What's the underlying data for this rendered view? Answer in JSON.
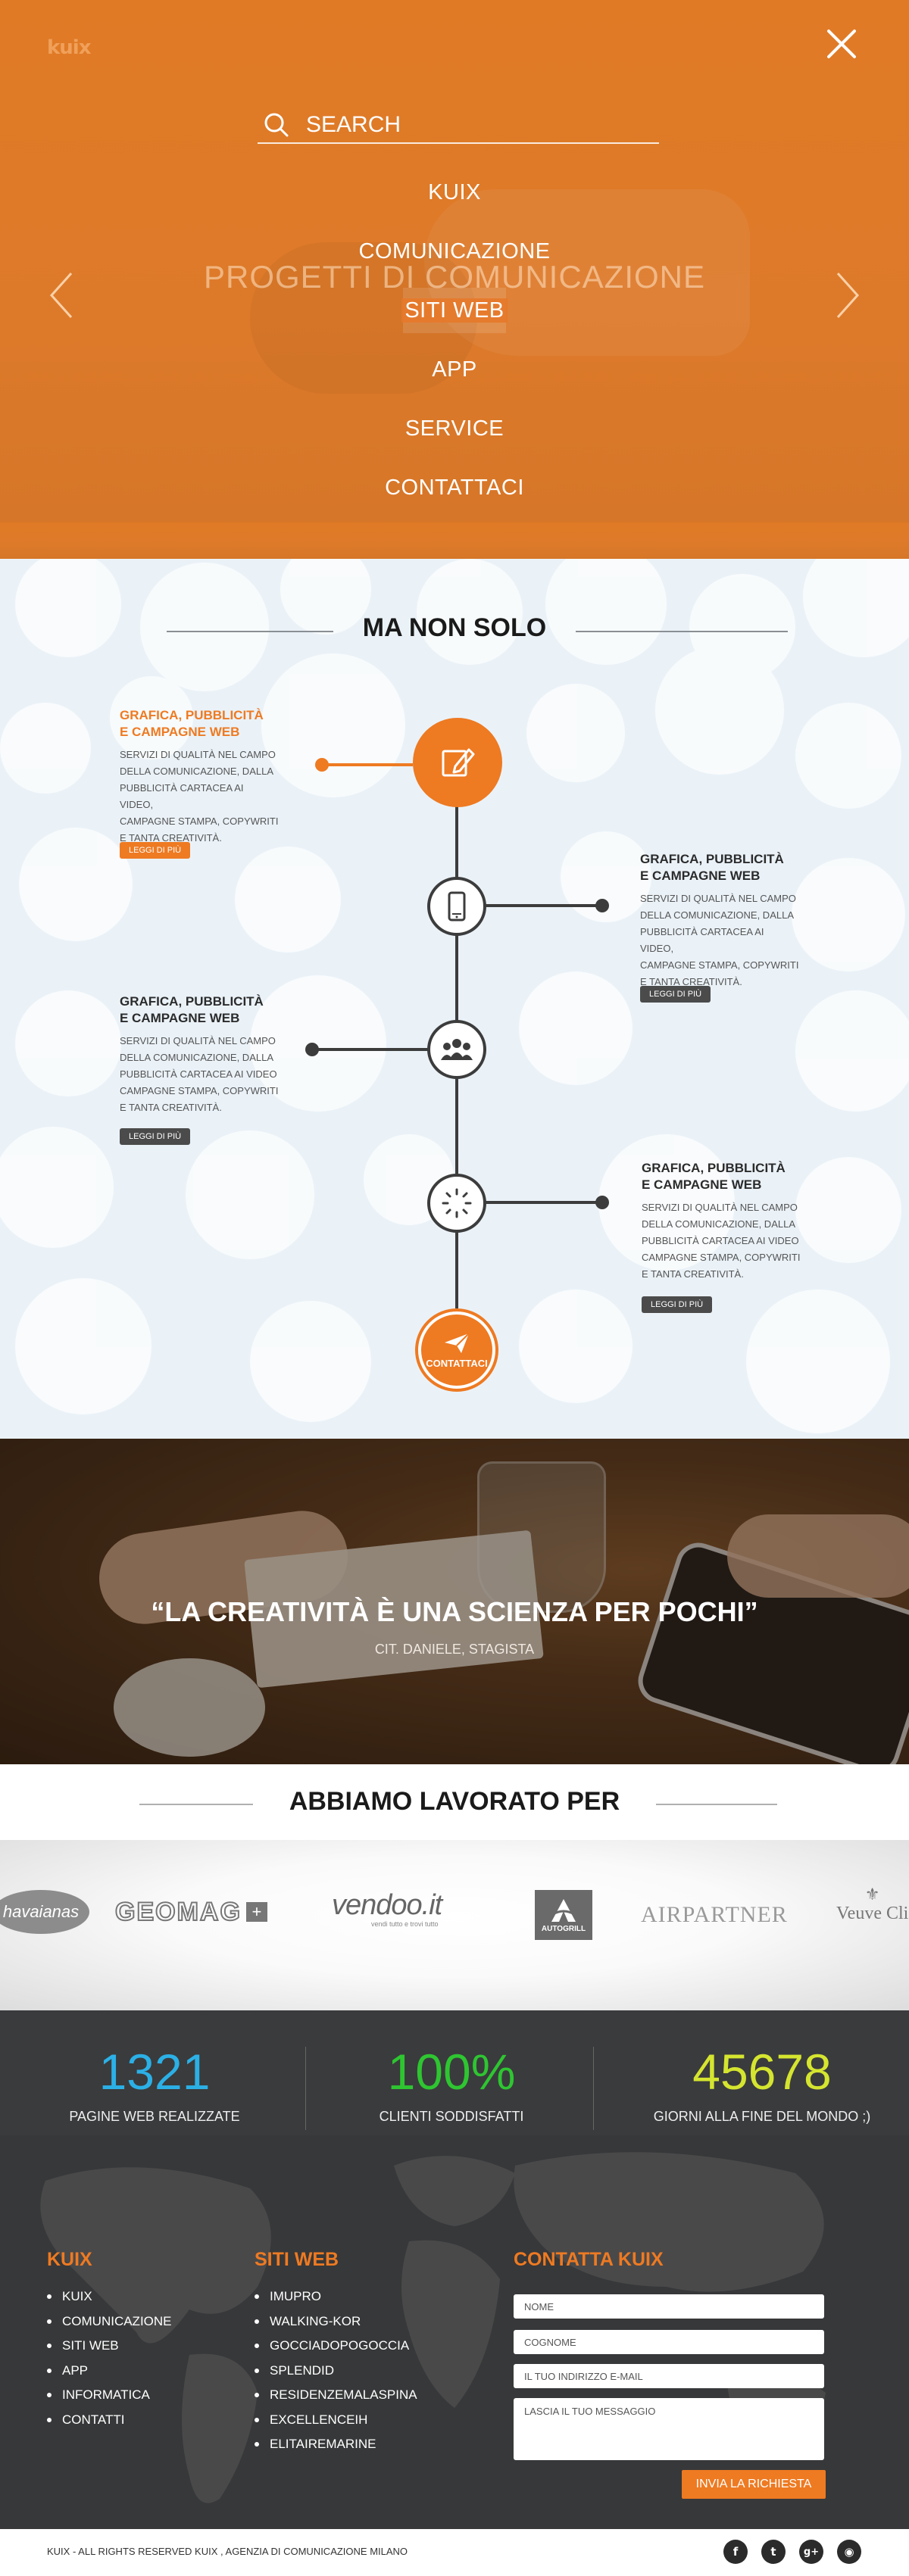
{
  "brand": {
    "logo": "kuix",
    "accent": "#ee7a22"
  },
  "search": {
    "placeholder": "SEARCH"
  },
  "hero": {
    "slide_title": "PROGETTI DI COMUNICAZIONE"
  },
  "menu": [
    {
      "label": "KUIX"
    },
    {
      "label": "COMUNICAZIONE"
    },
    {
      "label": "SITI WEB"
    },
    {
      "label": "APP"
    },
    {
      "label": "SERVICE"
    },
    {
      "label": "CONTATTACI"
    }
  ],
  "services": {
    "title": "MA NON SOLO",
    "items": [
      {
        "title_1": "GRAFICA, PUBBLICITÀ",
        "title_2": "E CAMPAGNE WEB",
        "lines": [
          "SERVIZI DI QUALITÀ NEL CAMPO",
          "DELLA COMUNICAZIONE, DALLA",
          "PUBBLICITÀ CARTACEA AI VIDEO,",
          "CAMPAGNE STAMPA, COPYWRITI",
          "E TANTA CREATIVITÀ."
        ],
        "button": "LEGGI DI PIÙ",
        "icon": "edit-icon"
      },
      {
        "title_1": "GRAFICA, PUBBLICITÀ",
        "title_2": "E CAMPAGNE WEB",
        "lines": [
          "SERVIZI DI QUALITÀ NEL CAMPO",
          "DELLA COMUNICAZIONE, DALLA",
          "PUBBLICITÀ CARTACEA AI VIDEO,",
          "CAMPAGNE STAMPA, COPYWRITI",
          "E TANTA CREATIVITÀ."
        ],
        "button": "LEGGI DI PIÙ",
        "icon": "smartphone-icon"
      },
      {
        "title_1": "GRAFICA, PUBBLICITÀ",
        "title_2": "E CAMPAGNE WEB",
        "lines": [
          "SERVIZI DI QUALITÀ NEL CAMPO",
          "DELLA COMUNICAZIONE, DALLA",
          "PUBBLICITÀ CARTACEA AI VIDEO",
          "CAMPAGNE STAMPA, COPYWRITI",
          "E TANTA CREATIVITÀ."
        ],
        "button": "LEGGI DI PIÙ",
        "icon": "people-icon"
      },
      {
        "title_1": "GRAFICA, PUBBLICITÀ",
        "title_2": "E CAMPAGNE WEB",
        "lines": [
          "SERVIZI DI QUALITÀ NEL CAMPO",
          "DELLA COMUNICAZIONE, DALLA",
          "PUBBLICITÀ CARTACEA AI VIDEO",
          "CAMPAGNE STAMPA, COPYWRITI",
          "E TANTA CREATIVITÀ."
        ],
        "button": "LEGGI DI PIÙ",
        "icon": "loading-icon"
      }
    ],
    "contact_label": "CONTATTACI"
  },
  "quote": {
    "text": "“LA CREATIVITÀ È UNA SCIENZA PER POCHI”",
    "cite": "CIT. DANIELE, STAGISTA"
  },
  "clients": {
    "title": "ABBIAMO LAVORATO PER",
    "logos": [
      "havaianas",
      "GEOMAG",
      "vendoo.it",
      "vendi tutto e trovi tutto",
      "AUTOGRILL",
      "AIRPARTNER",
      "Veuve Cli"
    ]
  },
  "stats": [
    {
      "value": "1321",
      "label": "PAGINE WEB REALIZZATE",
      "color": "#2bb0e6"
    },
    {
      "value": "100%",
      "label": "CLIENTI SODDISFATTI",
      "color": "#2ec531"
    },
    {
      "value": "45678",
      "label": "GIORNI ALLA FINE DEL MONDO ;)",
      "color": "#d5e52f"
    }
  ],
  "footer": {
    "col1_title": "KUIX",
    "col1_items": [
      "KUIX",
      "COMUNICAZIONE",
      "SITI WEB",
      "APP",
      "INFORMATICA",
      "CONTATTI"
    ],
    "col2_title": "SITI WEB",
    "col2_items": [
      "IMUPRO",
      "WALKING-KOR",
      "GOCCIADOPOGOCCIA",
      "SPLENDID",
      "RESIDENZEMALASPINA",
      "EXCELLENCEIH",
      "ELITAIREMARINE"
    ],
    "form_title": "CONTATTA KUIX",
    "form": {
      "name": "NOME",
      "surname": "COGNOME",
      "email": "IL TUO INDIRIZZO E-MAIL",
      "message": "LASCIA IL TUO MESSAGGIO",
      "submit": "INVIA LA RICHIESTA"
    },
    "copyright": "KUIX - ALL RIGHTS RESERVED KUIX , AGENZIA DI COMUNICAZIONE MILANO",
    "social": [
      {
        "icon": "facebook-icon",
        "glyph": "f"
      },
      {
        "icon": "twitter-icon",
        "glyph": "t"
      },
      {
        "icon": "google-plus-icon",
        "glyph": "g+"
      },
      {
        "icon": "rss-icon",
        "glyph": "◉"
      }
    ]
  }
}
